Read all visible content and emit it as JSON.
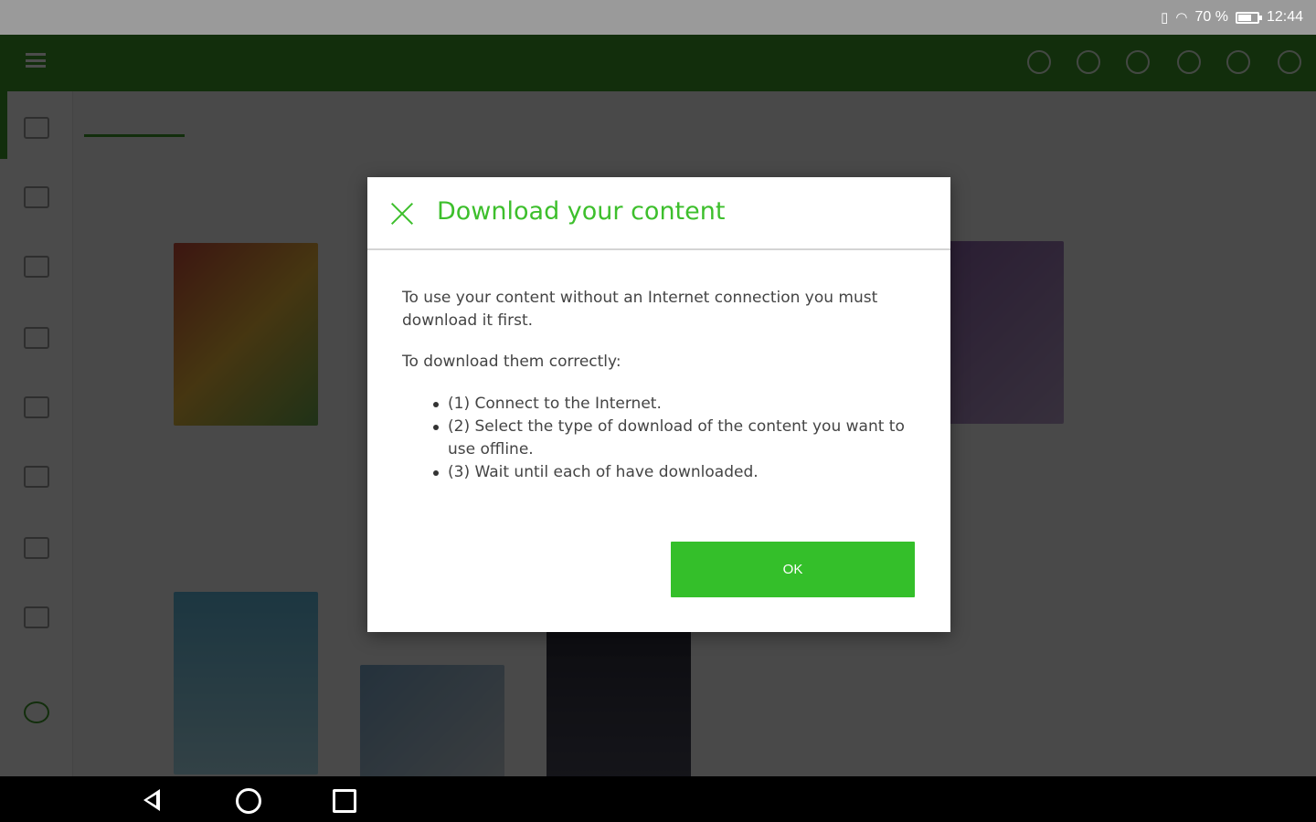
{
  "status_bar": {
    "battery_level": "70 %",
    "battery_fraction": 0.7,
    "time": "12:44"
  },
  "colors": {
    "accent": "#3dbf2c",
    "ok_button": "#34bf2a",
    "app_bar": "#3f9b2a"
  },
  "dialog": {
    "title": "Download your content",
    "close_icon": "close-icon",
    "intro": "To use your content without an Internet connection you must download it first.",
    "steps_heading": "To download them correctly:",
    "steps": [
      "(1) Connect to the Internet.",
      "(2) Select the type of download of the content you want to use offline.",
      "(3) Wait until each of have downloaded."
    ],
    "ok_label": "OK"
  },
  "nav_bar": {
    "icons": [
      "back-icon",
      "home-icon",
      "recents-icon"
    ]
  }
}
